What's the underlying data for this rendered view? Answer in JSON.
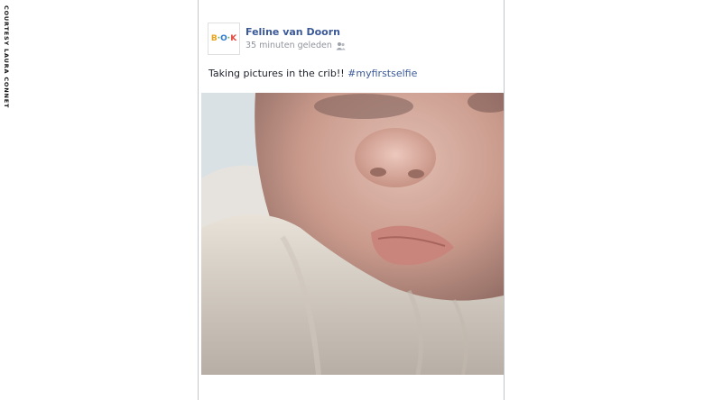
{
  "credit": "COURTESY LAURA CONNET",
  "post": {
    "avatar": {
      "letters": [
        "B",
        "O",
        "K"
      ],
      "separator": "·"
    },
    "author": "Feline van Doorn",
    "timestamp": "35 minuten geleden",
    "audience_icon": "friends-icon",
    "caption_text": "Taking pictures in the crib!! ",
    "hashtag": "#myfirstselfie",
    "photo_icon": "baby-selfie-photo"
  },
  "colors": {
    "author_link": "#3b5998",
    "meta_text": "#90949c",
    "border": "#c4c7cc"
  }
}
